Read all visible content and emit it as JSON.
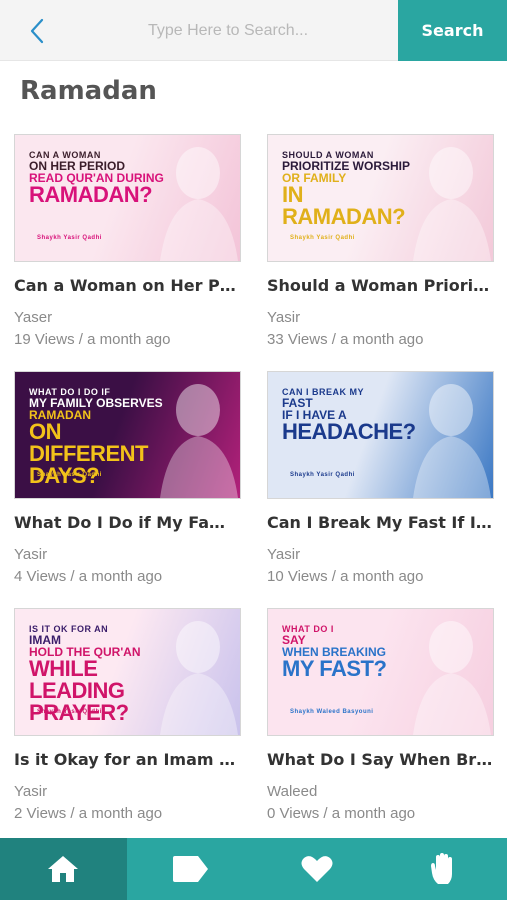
{
  "search": {
    "placeholder": "Type Here to Search...",
    "button_label": "Search"
  },
  "section": {
    "title": "Ramadan"
  },
  "videos": [
    {
      "title": "Can a Woman on Her Pe...",
      "author": "Yaser",
      "meta": "19 Views / a month ago",
      "thumb": {
        "line1": "Can a Woman",
        "line2": "On Her Period",
        "line3": "Read Qur'an During",
        "line4": "Ramadan?",
        "byline": "Shaykh Yasir Qadhi",
        "colors": [
          "#fbe7ef",
          "#f3c4d8"
        ],
        "accent": "#d8127a",
        "dark": "#3a1d2a"
      }
    },
    {
      "title": "Should a Woman Priorit...",
      "author": "Yasir",
      "meta": "33 Views / a month ago",
      "thumb": {
        "line1": "Should a Woman",
        "line2": "Prioritize Worship",
        "line3": "Or Family",
        "line4": "In Ramadan?",
        "byline": "Shaykh Yasir Qadhi",
        "colors": [
          "#fbeef3",
          "#f3c9d9"
        ],
        "accent": "#e0b01a",
        "dark": "#2b1a3a"
      }
    },
    {
      "title": "What Do I Do if My Fami...",
      "author": "Yasir",
      "meta": "4 Views / a month ago",
      "thumb": {
        "line1": "What Do I Do If",
        "line2": "My Family Observes",
        "line3": "Ramadan",
        "line4": "On Different Days?",
        "byline": "Shaykh Yasir Qadhi",
        "colors": [
          "#3b0f45",
          "#b2217a"
        ],
        "accent": "#f2c21a",
        "dark": "#ffffff"
      }
    },
    {
      "title": "Can I Break My Fast If I...",
      "author": "Yasir",
      "meta": "10 Views / a month ago",
      "thumb": {
        "line1": "Can I Break My",
        "line2": "Fast",
        "line3": "If I Have a",
        "line4": "Headache?",
        "byline": "Shaykh Yasir Qadhi",
        "colors": [
          "#dfe7f5",
          "#3b78c4"
        ],
        "accent": "#1b3a8c",
        "dark": "#1b3a8c"
      }
    },
    {
      "title": "Is it Okay for an Imam t...",
      "author": "Yasir",
      "meta": "2 Views / a month ago",
      "thumb": {
        "line1": "Is It OK For An",
        "line2": "Imam",
        "line3": "Hold The Qur'an",
        "line4": "While Leading Prayer?",
        "byline": "Shaykh Yasir Qadhi",
        "colors": [
          "#fde9f2",
          "#c9c2ec"
        ],
        "accent": "#d01469",
        "dark": "#3a1d6a"
      }
    },
    {
      "title": "What Do I Say When Bre...",
      "author": "Waleed",
      "meta": "0 Views / a month ago",
      "thumb": {
        "line1": "What Do I",
        "line2": "Say",
        "line3": "When Breaking",
        "line4": "My Fast?",
        "byline": "Shaykh Waleed Basyouni",
        "colors": [
          "#fce4ef",
          "#f6cfe0"
        ],
        "accent": "#2a73c9",
        "dark": "#d01469"
      }
    }
  ],
  "nav": [
    {
      "name": "home",
      "icon": "home-icon"
    },
    {
      "name": "tags",
      "icon": "tag-icon"
    },
    {
      "name": "favorites",
      "icon": "heart-icon"
    },
    {
      "name": "dua",
      "icon": "hand-icon"
    }
  ],
  "colors": {
    "brand": "#2aa6a1",
    "brand_dark": "#20827e"
  }
}
